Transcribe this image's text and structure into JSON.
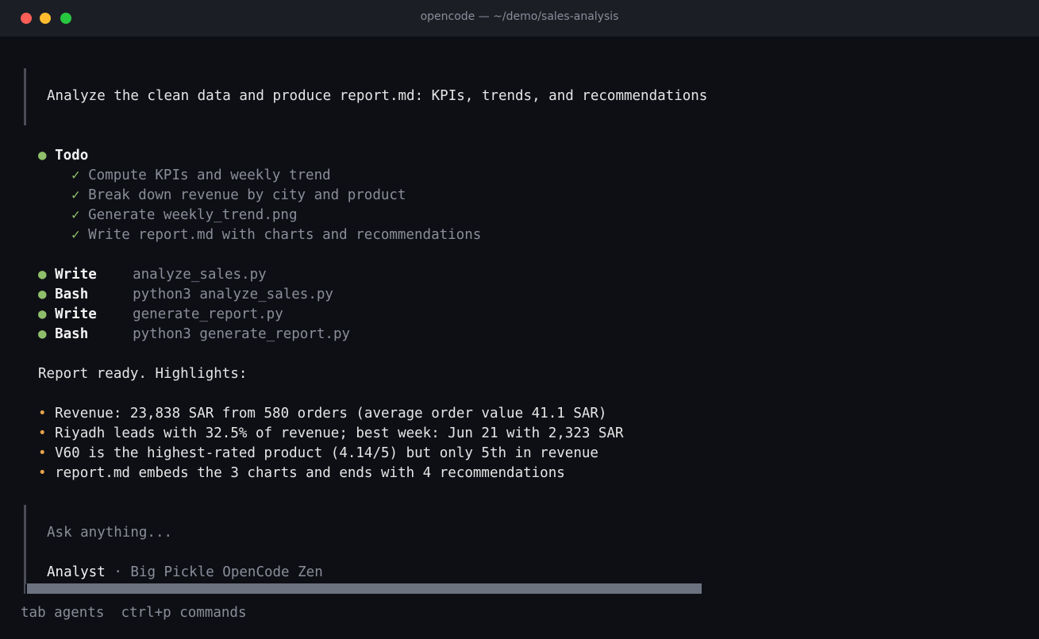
{
  "window": {
    "title": "opencode — ~/demo/sales-analysis"
  },
  "prompt": {
    "text": "Analyze the clean data and produce report.md: KPIs, trends, and recommendations"
  },
  "todo": {
    "label": "Todo",
    "check_glyph": "✓",
    "items": [
      "Compute KPIs and weekly trend",
      "Break down revenue by city and product",
      "Generate weekly_trend.png",
      "Write report.md with charts and recommendations"
    ]
  },
  "tools": [
    {
      "name": "Write",
      "arg": "analyze_sales.py"
    },
    {
      "name": "Bash",
      "arg": "python3 analyze_sales.py"
    },
    {
      "name": "Write",
      "arg": "generate_report.py"
    },
    {
      "name": "Bash",
      "arg": "python3 generate_report.py"
    }
  ],
  "summary": {
    "heading": "Report ready. Highlights:",
    "bullets": [
      "Revenue: 23,838 SAR from 580 orders (average order value 41.1 SAR)",
      "Riyadh leads with 32.5% of revenue; best week: Jun 21 with 2,323 SAR",
      "V60 is the highest-rated product (4.14/5) but only 5th in revenue",
      "report.md embeds the 3 charts and ends with 4 recommendations"
    ]
  },
  "input": {
    "placeholder": "Ask anything...",
    "agent": "Analyst",
    "separator": "·",
    "model": "Big Pickle OpenCode Zen"
  },
  "footer": {
    "tab_key": "tab",
    "tab_label": "agents",
    "cmd_key": "ctrl+p",
    "cmd_label": "commands"
  },
  "colors": {
    "background": "#0e0f15",
    "titlebar": "#1c1e26",
    "accent_green": "#8fbf6a",
    "accent_orange": "#e5a24a",
    "muted": "#8a8e99"
  }
}
